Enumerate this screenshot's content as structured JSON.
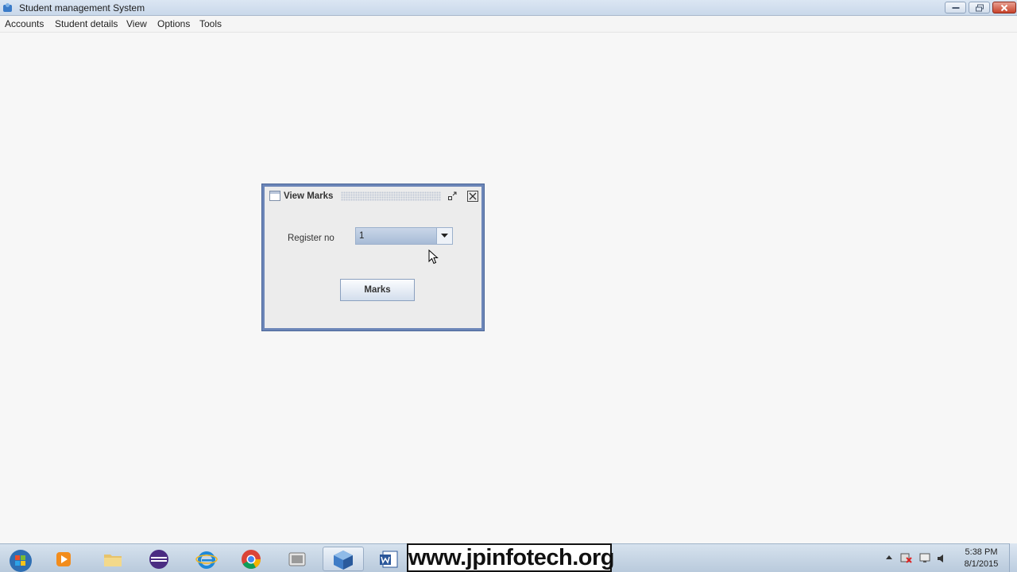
{
  "window": {
    "title": "Student management System"
  },
  "menubar": {
    "items": [
      "Accounts",
      "Student details",
      "View",
      "Options",
      "Tools"
    ]
  },
  "dialog": {
    "title": "View Marks",
    "register_label": "Register no",
    "register_value": "1",
    "marks_button": "Marks"
  },
  "taskbar": {
    "watermark": "www.jpinfotech.org",
    "time": "5:38 PM",
    "date": "8/1/2015",
    "icons": [
      "start-orb",
      "media-player",
      "file-explorer",
      "eclipse",
      "internet-explorer",
      "chrome",
      "video-app",
      "java-app",
      "word"
    ]
  },
  "colors": {
    "frame_border": "#6c86b8",
    "titlebar": "#dbe6f3"
  }
}
